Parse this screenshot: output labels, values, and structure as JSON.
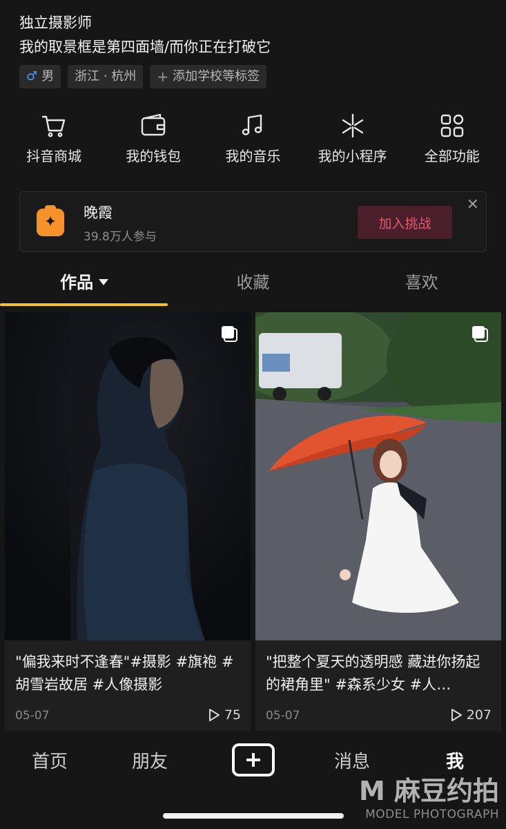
{
  "profile": {
    "name": "独立摄影师",
    "bio": "我的取景框是第四面墙/而你正在打破它",
    "tags": [
      {
        "icon": "male-icon",
        "symbol": "♂",
        "label": "男"
      },
      {
        "label": "浙江 · 杭州"
      },
      {
        "icon": "plus-icon",
        "symbol": "+",
        "label": "添加学校等标签"
      }
    ]
  },
  "features": [
    {
      "icon": "shopping-cart-icon",
      "label": "抖音商城"
    },
    {
      "icon": "wallet-icon",
      "label": "我的钱包"
    },
    {
      "icon": "music-note-icon",
      "label": "我的音乐"
    },
    {
      "icon": "mini-program-icon",
      "label": "我的小程序"
    },
    {
      "icon": "grid-apps-icon",
      "label": "全部功能"
    }
  ],
  "challenge": {
    "title": "晚霞",
    "participants": "39.8万人参与",
    "join_label": "加入挑战",
    "close_symbol": "✕",
    "icon_symbol": "✦"
  },
  "tabs": [
    {
      "label": "作品",
      "active": true
    },
    {
      "label": "收藏"
    },
    {
      "label": "喜欢"
    }
  ],
  "posts": [
    {
      "caption": "\"偏我来时不逢春\"#摄影 #旗袍 #胡雪岩故居  #人像摄影",
      "date": "05-07",
      "plays": "75"
    },
    {
      "caption": "\"把整个夏天的透明感 藏进你扬起的裙角里\" #森系少女 #人…",
      "date": "05-07",
      "plays": "207"
    }
  ],
  "nav": {
    "home": "首页",
    "friends": "朋友",
    "messages": "消息",
    "me": "我"
  },
  "watermark": {
    "main": "M 麻豆约拍",
    "sub": "MODEL PHOTOGRAPH"
  },
  "colors": {
    "background": "#161616",
    "accent_underline": "#f5c12a",
    "join_button_bg": "#4a1e2a",
    "join_button_text": "#e05a70",
    "challenge_icon": "#f5922a",
    "gender_male": "#4f9bf5"
  }
}
